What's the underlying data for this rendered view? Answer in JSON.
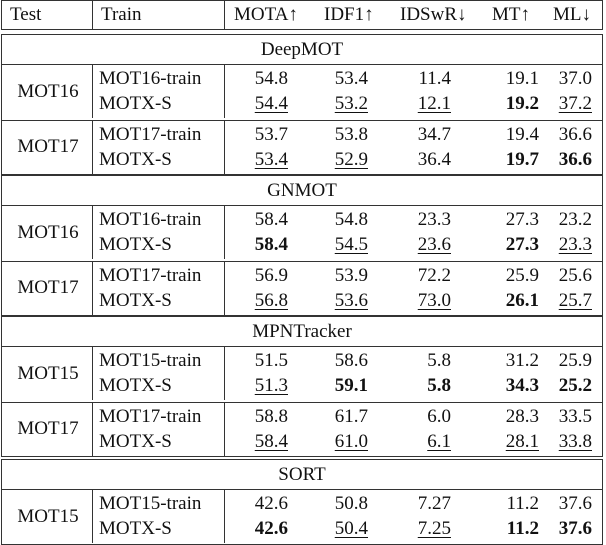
{
  "header": {
    "test": "Test",
    "train": "Train",
    "metrics": [
      "MOTA↑",
      "IDF1↑",
      "IDSwR↓",
      "MT↑",
      "ML↓"
    ]
  },
  "sections": [
    {
      "title": "DeepMOT",
      "groups": [
        {
          "test": "MOT16",
          "rows": [
            {
              "train": "MOT16-train",
              "values": [
                "54.8",
                "53.4",
                "11.4",
                "19.1",
                "37.0"
              ],
              "styles": [
                "",
                "",
                "",
                "",
                ""
              ]
            },
            {
              "train": "MOTX-S",
              "values": [
                "54.4",
                "53.2",
                "12.1",
                "19.2",
                "37.2"
              ],
              "styles": [
                "u",
                "u",
                "u",
                "b",
                "u"
              ]
            }
          ]
        },
        {
          "test": "MOT17",
          "rows": [
            {
              "train": "MOT17-train",
              "values": [
                "53.7",
                "53.8",
                "34.7",
                "19.4",
                "36.6"
              ],
              "styles": [
                "",
                "",
                "",
                "",
                ""
              ]
            },
            {
              "train": "MOTX-S",
              "values": [
                "53.4",
                "52.9",
                "36.4",
                "19.7",
                "36.6"
              ],
              "styles": [
                "u",
                "u",
                "",
                "b",
                "b"
              ]
            }
          ]
        }
      ]
    },
    {
      "title": "GNMOT",
      "groups": [
        {
          "test": "MOT16",
          "rows": [
            {
              "train": "MOT16-train",
              "values": [
                "58.4",
                "54.8",
                "23.3",
                "27.3",
                "23.2"
              ],
              "styles": [
                "",
                "",
                "",
                "",
                ""
              ]
            },
            {
              "train": "MOTX-S",
              "values": [
                "58.4",
                "54.5",
                "23.6",
                "27.3",
                "23.3"
              ],
              "styles": [
                "b",
                "u",
                "u",
                "b",
                "u"
              ]
            }
          ]
        },
        {
          "test": "MOT17",
          "rows": [
            {
              "train": "MOT17-train",
              "values": [
                "56.9",
                "53.9",
                "72.2",
                "25.9",
                "25.6"
              ],
              "styles": [
                "",
                "",
                "",
                "",
                ""
              ]
            },
            {
              "train": "MOTX-S",
              "values": [
                "56.8",
                "53.6",
                "73.0",
                "26.1",
                "25.7"
              ],
              "styles": [
                "u",
                "u",
                "u",
                "b",
                "u"
              ]
            }
          ]
        }
      ]
    },
    {
      "title": "MPNTracker",
      "groups": [
        {
          "test": "MOT15",
          "rows": [
            {
              "train": "MOT15-train",
              "values": [
                "51.5",
                "58.6",
                "5.8",
                "31.2",
                "25.9"
              ],
              "styles": [
                "",
                "",
                "",
                "",
                ""
              ]
            },
            {
              "train": "MOTX-S",
              "values": [
                "51.3",
                "59.1",
                "5.8",
                "34.3",
                "25.2"
              ],
              "styles": [
                "u",
                "b",
                "b",
                "b",
                "b"
              ]
            }
          ]
        },
        {
          "test": "MOT17",
          "rows": [
            {
              "train": "MOT17-train",
              "values": [
                "58.8",
                "61.7",
                "6.0",
                "28.3",
                "33.5"
              ],
              "styles": [
                "",
                "",
                "",
                "",
                ""
              ]
            },
            {
              "train": "MOTX-S",
              "values": [
                "58.4",
                "61.0",
                "6.1",
                "28.1",
                "33.8"
              ],
              "styles": [
                "u",
                "u",
                "u",
                "u",
                "u"
              ]
            }
          ]
        }
      ]
    },
    {
      "title": "SORT",
      "groups": [
        {
          "test": "MOT15",
          "rows": [
            {
              "train": "MOT15-train",
              "values": [
                "42.6",
                "50.8",
                "7.27",
                "11.2",
                "37.6"
              ],
              "styles": [
                "",
                "",
                "",
                "",
                ""
              ]
            },
            {
              "train": "MOTX-S",
              "values": [
                "42.6",
                "50.4",
                "7.25",
                "11.2",
                "37.6"
              ],
              "styles": [
                "b",
                "u",
                "u",
                "b",
                "b"
              ]
            }
          ]
        }
      ]
    }
  ]
}
